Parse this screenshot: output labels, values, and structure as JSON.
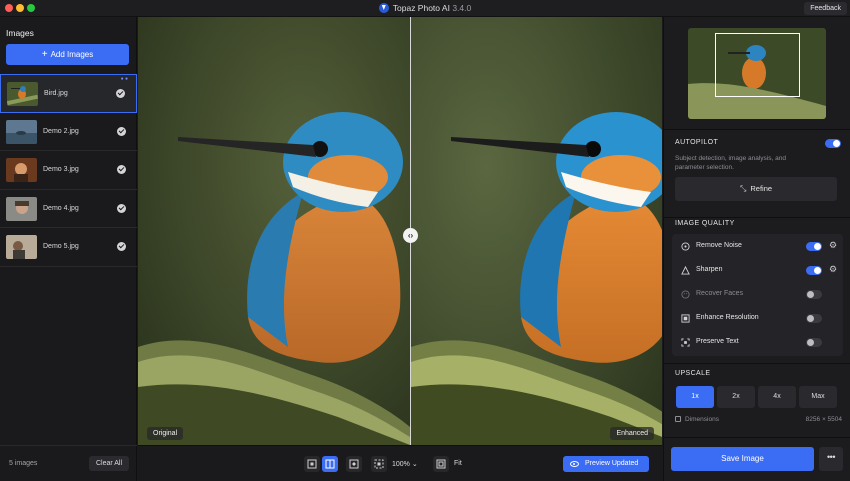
{
  "titlebar": {
    "app_name": "Topaz Photo AI",
    "version": "3.4.0",
    "feedback_label": "Feedback"
  },
  "sidebar": {
    "title": "Images",
    "add_label": "Add Images",
    "items": [
      {
        "name": "Bird.jpg",
        "selected": true
      },
      {
        "name": "Demo 2.jpg",
        "selected": false
      },
      {
        "name": "Demo 3.jpg",
        "selected": false
      },
      {
        "name": "Demo 4.jpg",
        "selected": false
      },
      {
        "name": "Demo 5.jpg",
        "selected": false
      }
    ],
    "count_label": "5 images",
    "clear_label": "Clear All"
  },
  "canvas": {
    "original_label": "Original",
    "enhanced_label": "Enhanced",
    "handle_glyph": "‹›"
  },
  "toolbar": {
    "zoom_value": "100%",
    "fit_label": "Fit",
    "preview_label": "Preview Updated"
  },
  "autopilot": {
    "title": "AUTOPILOT",
    "enabled": true,
    "description": "Subject detection, image analysis, and parameter selection.",
    "refine_label": "Refine"
  },
  "image_quality": {
    "title": "IMAGE QUALITY",
    "rows": [
      {
        "label": "Remove Noise",
        "enabled": true,
        "icon": "noise-icon",
        "has_settings": true
      },
      {
        "label": "Sharpen",
        "enabled": true,
        "icon": "triangle-icon",
        "has_settings": true
      },
      {
        "label": "Recover Faces",
        "enabled": false,
        "icon": "face-icon",
        "has_settings": false
      },
      {
        "label": "Enhance Resolution",
        "enabled": false,
        "icon": "resolution-icon",
        "has_settings": false
      },
      {
        "label": "Preserve Text",
        "enabled": false,
        "icon": "text-icon",
        "has_settings": false
      }
    ]
  },
  "upscale": {
    "title": "UPSCALE",
    "options": [
      "1x",
      "2x",
      "4x",
      "Max"
    ],
    "selected": "1x",
    "dimensions_label": "Dimensions",
    "dimensions_value": "8256 × 5504"
  },
  "save": {
    "save_label": "Save Image",
    "more_label": "•••"
  },
  "colors": {
    "accent": "#3b6cf4",
    "background": "#1a1a1c",
    "panel": "#1c1c1f"
  }
}
